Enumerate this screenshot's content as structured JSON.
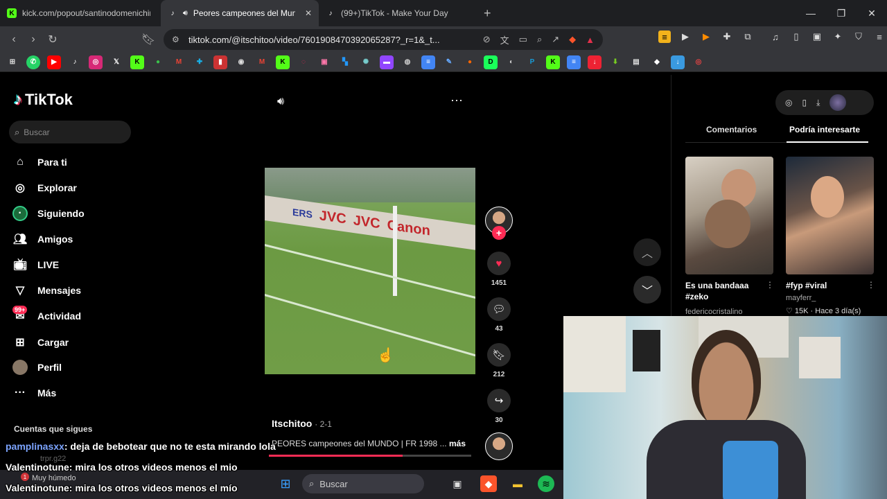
{
  "browser": {
    "tabs": [
      {
        "label": "kick.com/popout/santinodomenichin",
        "icon": "kick-icon"
      },
      {
        "label": "Peores campeones del Mund",
        "icon": "tiktok-icon",
        "active": true
      },
      {
        "label": "(99+)TikTok - Make Your Day",
        "icon": "tiktok-icon"
      }
    ],
    "new_tab": "+",
    "url": "tiktok.com/@itschitoo/video/7601908470392065287?_r=1&_t...",
    "window_controls": [
      "minimize",
      "maximize",
      "close"
    ]
  },
  "tiktok": {
    "brand": "TikTok",
    "search_placeholder": "Buscar",
    "menu": [
      {
        "label": "Para ti",
        "icon": "home-icon"
      },
      {
        "label": "Explorar",
        "icon": "compass-icon"
      },
      {
        "label": "Siguiendo",
        "icon": "following-icon"
      },
      {
        "label": "Amigos",
        "icon": "friends-icon"
      },
      {
        "label": "LIVE",
        "icon": "live-icon"
      },
      {
        "label": "Mensajes",
        "icon": "messages-icon"
      },
      {
        "label": "Actividad",
        "icon": "activity-icon",
        "badge": "99+"
      },
      {
        "label": "Cargar",
        "icon": "upload-icon"
      },
      {
        "label": "Perfil",
        "icon": "profile-icon"
      },
      {
        "label": "Más",
        "icon": "more-icon"
      }
    ],
    "following_section_title": "Cuentas que sigues",
    "following_user": "trpr.g22",
    "video": {
      "author": "Itschitoo",
      "date": "· 2-1",
      "description": "PEORES campeones del MUNDO | FR 1998 ...",
      "more": "más",
      "progress_percent": 66,
      "board_texts": [
        "ERS",
        "JVC",
        "JVC",
        "Canon"
      ]
    },
    "actions": {
      "likes": "1451",
      "comments": "43",
      "saves": "212",
      "shares": "30"
    },
    "right_panel": {
      "tabs": [
        "Comentarios",
        "Podría interesarte"
      ],
      "active_tab": "Podría interesarte",
      "videos": [
        {
          "caption": "Es una bandaaa #zeko",
          "user": "federicocristalino"
        },
        {
          "caption": "#fyp #viral",
          "user": "mayferr_",
          "stats": "♡ 15K · Hace 3 día(s)"
        }
      ]
    }
  },
  "chat": [
    {
      "user": "pamplinasxx",
      "message": ": deja de bebotear que no te esta mirando lola",
      "color": "#7ca4ff"
    },
    {
      "user": "Valentinotune",
      "message": ": mira los otros videos menos el mio",
      "color": "#ffffff"
    },
    {
      "user": "Valentinotune",
      "message": ": mira los otros videos menos el mío",
      "color": "#ffffff"
    }
  ],
  "taskbar": {
    "weather": "Muy húmedo",
    "weather_badge": "1",
    "search": "Buscar"
  }
}
